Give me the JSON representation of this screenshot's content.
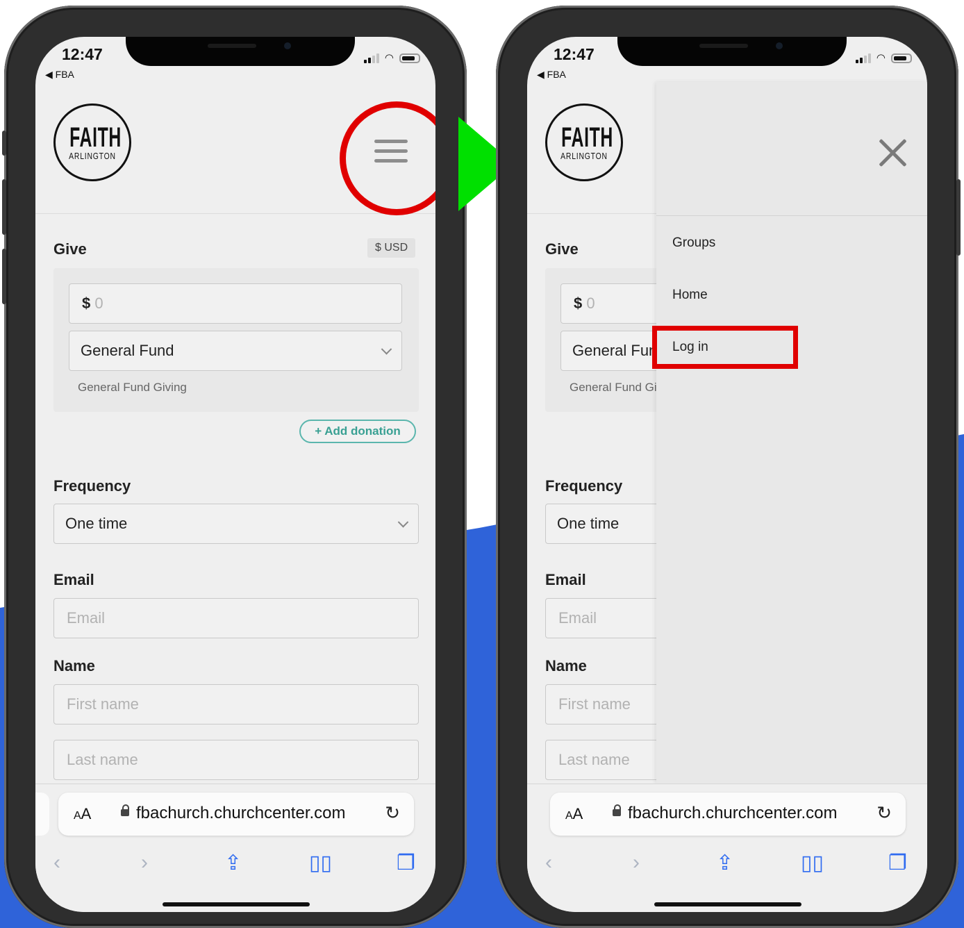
{
  "status_bar": {
    "time": "12:47",
    "back_app": "◀ FBA"
  },
  "logo": {
    "line1": "FAITH",
    "line2": "ARLINGTON"
  },
  "give": {
    "title": "Give",
    "currency": "$ USD",
    "amount_prefix": "$",
    "amount_placeholder": "0",
    "fund": "General Fund",
    "fund_description": "General Fund Giving",
    "add_donation": "+ Add donation"
  },
  "frequency": {
    "label": "Frequency",
    "value": "One time"
  },
  "email": {
    "label": "Email",
    "placeholder": "Email"
  },
  "name": {
    "label": "Name",
    "first_placeholder": "First name",
    "last_placeholder": "Last name"
  },
  "browser": {
    "aa_small": "A",
    "aa_large": "A",
    "url": "fbachurch.churchcenter.com"
  },
  "nav_menu": {
    "items": [
      {
        "label": "Groups"
      },
      {
        "label": "Home"
      },
      {
        "label": "Log in"
      }
    ]
  },
  "icons": {
    "hamburger": "hamburger-menu-icon",
    "close": "close-icon",
    "lock": "lock-icon",
    "reload": "reload-icon",
    "back": "back-arrow-icon",
    "forward": "forward-arrow-icon",
    "share": "share-icon",
    "bookmarks": "bookmarks-icon",
    "tabs": "tabs-icon"
  },
  "colors": {
    "annotation_red": "#e00000",
    "arrow_green": "#00e000",
    "background_blue": "#2f63d9",
    "accent_teal": "#39a093",
    "safari_blue": "#2f6bf0"
  }
}
